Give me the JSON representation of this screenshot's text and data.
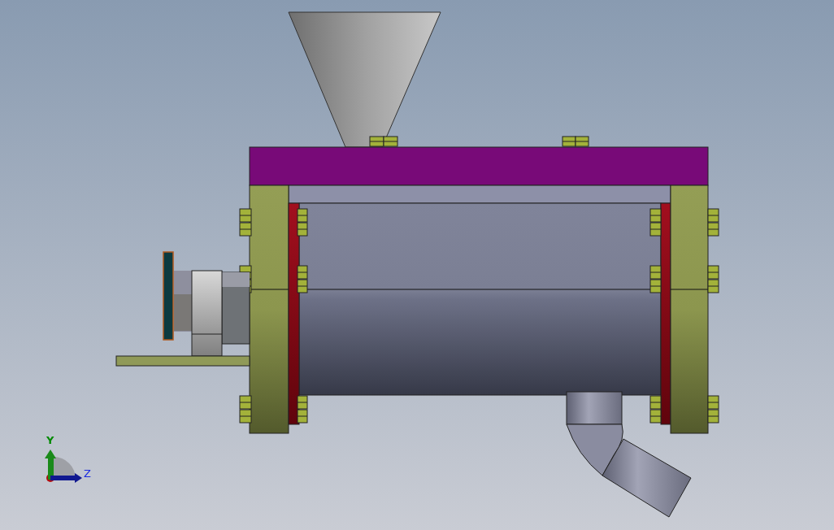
{
  "axis_triad": {
    "y_label": "Y",
    "z_label": "Z"
  }
}
